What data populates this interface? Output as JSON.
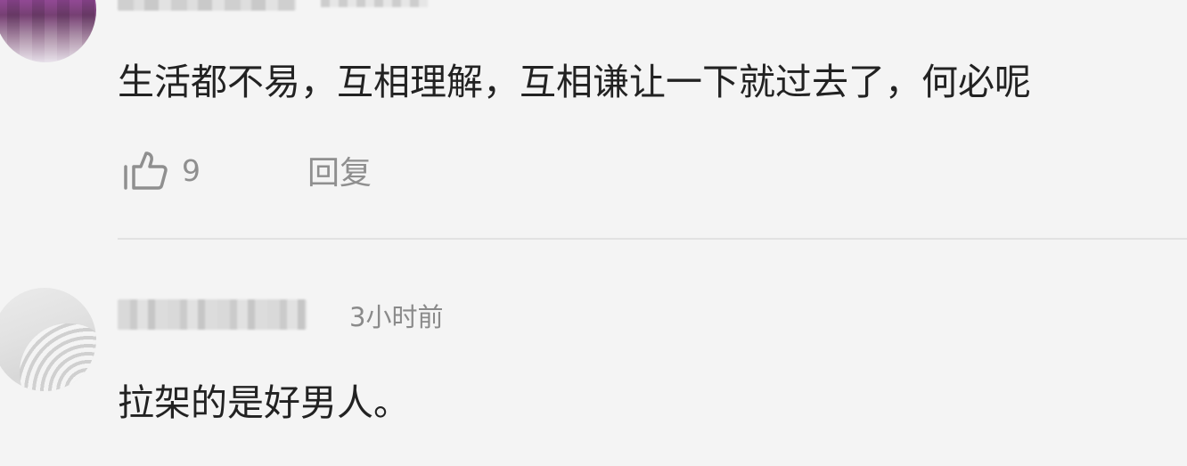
{
  "comments": [
    {
      "text": "生活都不易，互相理解，互相谦让一下就过去了，何必呢",
      "like_count": "9",
      "reply_label": "回复"
    },
    {
      "time": "3小时前",
      "text": "拉架的是好男人。"
    }
  ],
  "icons": {
    "like": "thumbs-up-outline-icon"
  },
  "colors": {
    "background": "#f4f4f4",
    "text_primary": "#222222",
    "text_secondary": "#8f8f8f",
    "divider": "#e2e2e2"
  }
}
